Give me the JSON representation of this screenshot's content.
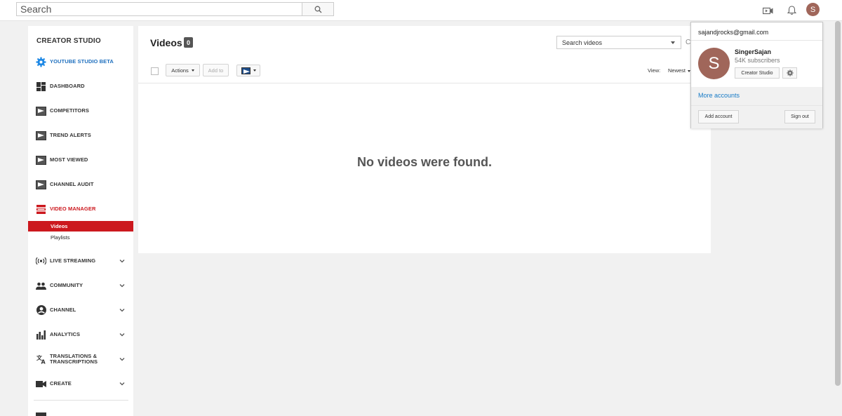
{
  "topbar": {
    "search_placeholder": "Search",
    "icons": [
      "search-icon",
      "upload-video-icon",
      "bell-icon"
    ],
    "avatar_letter": "S"
  },
  "sidebar": {
    "title": "CREATOR STUDIO",
    "items": [
      {
        "label": "YOUTUBE STUDIO BETA",
        "icon": "gear-icon"
      },
      {
        "label": "DASHBOARD",
        "icon": "dashboard-icon"
      },
      {
        "label": "COMPETITORS",
        "icon": "tubebuddy-icon"
      },
      {
        "label": "TREND ALERTS",
        "icon": "tubebuddy-icon"
      },
      {
        "label": "MOST VIEWED",
        "icon": "tubebuddy-icon"
      },
      {
        "label": "CHANNEL AUDIT",
        "icon": "tubebuddy-icon"
      },
      {
        "label": "VIDEO MANAGER",
        "icon": "video-manager-icon"
      },
      {
        "label": "LIVE STREAMING",
        "icon": "broadcast-icon"
      },
      {
        "label": "COMMUNITY",
        "icon": "people-icon"
      },
      {
        "label": "CHANNEL",
        "icon": "account-circle-icon"
      },
      {
        "label": "ANALYTICS",
        "icon": "bar-chart-icon"
      },
      {
        "label_line1": "TRANSLATIONS &",
        "label_line2": "TRANSCRIPTIONS",
        "icon": "translate-icon"
      },
      {
        "label": "CREATE",
        "icon": "video-camera-icon"
      }
    ],
    "sub_items": [
      "Videos",
      "Playlists"
    ],
    "active_color": "#cc181e"
  },
  "main": {
    "title": "Videos",
    "count": "0",
    "search_placeholder": "Search videos",
    "actions_label": "Actions",
    "add_to_label": "Add to",
    "view_label": "View:",
    "sort_label": "Newest",
    "empty_message": "No videos were found."
  },
  "account": {
    "email": "sajandjrocks@gmail.com",
    "avatar_letter": "S",
    "name": "SingerSajan",
    "subscribers": "54K subscribers",
    "creator_studio_label": "Creator Studio",
    "more_accounts_label": "More accounts",
    "add_account_label": "Add account",
    "sign_out_label": "Sign out"
  }
}
